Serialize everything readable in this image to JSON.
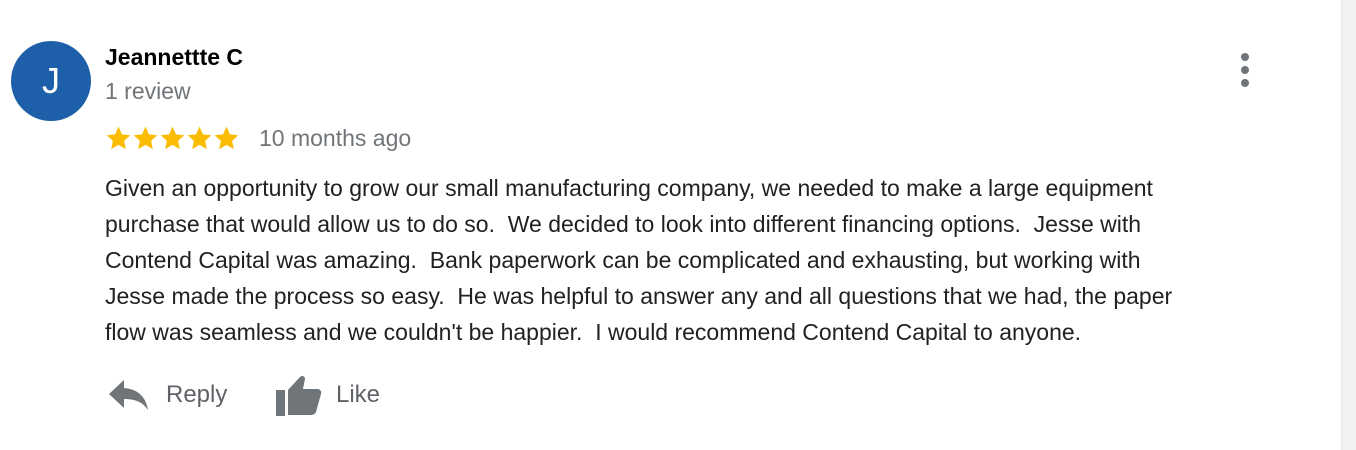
{
  "author": {
    "initial": "J",
    "name": "Jeannettte C",
    "review_count": "1 review",
    "avatar_color": "#1d5fa8"
  },
  "rating": {
    "stars": 5,
    "max_stars": 5,
    "star_color": "#fbbc04",
    "date": "10 months ago"
  },
  "review": {
    "text": "Given an opportunity to grow our small manufacturing company, we needed to make a large equipment\npurchase that would allow us to do so.  We decided to look into different financing options.  Jesse with\nContend Capital was amazing.  Bank paperwork can be complicated and exhausting, but working with\nJesse made the process so easy.  He was helpful to answer any and all questions that we had, the paper\nflow was seamless and we couldn't be happier.  I would recommend Contend Capital to anyone."
  },
  "actions": {
    "reply_label": "Reply",
    "like_label": "Like",
    "reply_icon": "reply-arrow-icon",
    "like_icon": "thumbs-up-icon",
    "more_icon": "more-vertical-icon"
  }
}
